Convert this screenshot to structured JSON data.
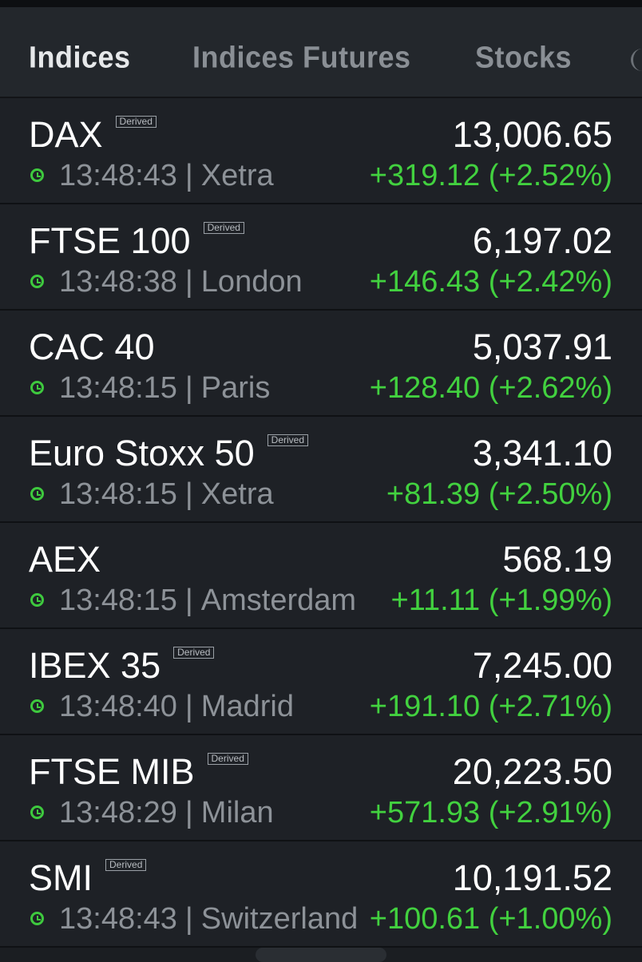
{
  "tabs": [
    {
      "label": "Indices",
      "active": true
    },
    {
      "label": "Indices Futures",
      "active": false
    },
    {
      "label": "Stocks",
      "active": false
    }
  ],
  "colors": {
    "positive": "#42d13f",
    "background": "#1e2126"
  },
  "rows": [
    {
      "name": "DAX",
      "badge": "Derived",
      "price": "13,006.65",
      "time": "13:48:43",
      "exchange": "Xetra",
      "change": "+319.12 (+2.52%)"
    },
    {
      "name": "FTSE 100",
      "badge": "Derived",
      "price": "6,197.02",
      "time": "13:48:38",
      "exchange": "London",
      "change": "+146.43 (+2.42%)"
    },
    {
      "name": "CAC 40",
      "badge": "",
      "price": "5,037.91",
      "time": "13:48:15",
      "exchange": "Paris",
      "change": "+128.40 (+2.62%)"
    },
    {
      "name": "Euro Stoxx 50",
      "badge": "Derived",
      "price": "3,341.10",
      "time": "13:48:15",
      "exchange": "Xetra",
      "change": "+81.39 (+2.50%)"
    },
    {
      "name": "AEX",
      "badge": "",
      "price": "568.19",
      "time": "13:48:15",
      "exchange": "Amsterdam",
      "change": "+11.11 (+1.99%)"
    },
    {
      "name": "IBEX 35",
      "badge": "Derived",
      "price": "7,245.00",
      "time": "13:48:40",
      "exchange": "Madrid",
      "change": "+191.10 (+2.71%)"
    },
    {
      "name": "FTSE MIB",
      "badge": "Derived",
      "price": "20,223.50",
      "time": "13:48:29",
      "exchange": "Milan",
      "change": "+571.93 (+2.91%)"
    },
    {
      "name": "SMI",
      "badge": "Derived",
      "price": "10,191.52",
      "time": "13:48:43",
      "exchange": "Switzerland",
      "change": "+100.61 (+1.00%)"
    }
  ]
}
